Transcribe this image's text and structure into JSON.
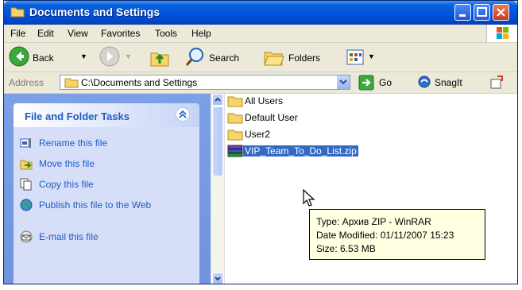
{
  "window": {
    "title": "Documents and Settings"
  },
  "menu": [
    "File",
    "Edit",
    "View",
    "Favorites",
    "Tools",
    "Help"
  ],
  "toolbar": {
    "back_label": "Back",
    "search_label": "Search",
    "folders_label": "Folders"
  },
  "address": {
    "label": "Address",
    "path": "C:\\Documents and Settings",
    "go_label": "Go",
    "snagit_label": "SnagIt"
  },
  "tasks": {
    "title": "File and Folder Tasks",
    "items": [
      {
        "label": "Rename this file",
        "icon": "rename-icon"
      },
      {
        "label": "Move this file",
        "icon": "move-icon"
      },
      {
        "label": "Copy this file",
        "icon": "copy-icon"
      },
      {
        "label": "Publish this file to the Web",
        "icon": "publish-icon"
      },
      {
        "label": "E-mail this file",
        "icon": "email-icon"
      }
    ]
  },
  "files": [
    {
      "name": "All Users",
      "type": "folder"
    },
    {
      "name": "Default User",
      "type": "folder"
    },
    {
      "name": "User2",
      "type": "folder"
    },
    {
      "name": "VIP_Team_To_Do_List.zip",
      "type": "zip",
      "selected": true
    }
  ],
  "tooltip": {
    "type": "Type: Архив ZIP - WinRAR",
    "modified": "Date Modified: 01/11/2007 15:23",
    "size": "Size: 6.53 MB"
  },
  "colors": {
    "titlebar": "#0054e3",
    "task_link": "#215dc6",
    "selection": "#316ac5",
    "tooltip_bg": "#ffffe1"
  }
}
